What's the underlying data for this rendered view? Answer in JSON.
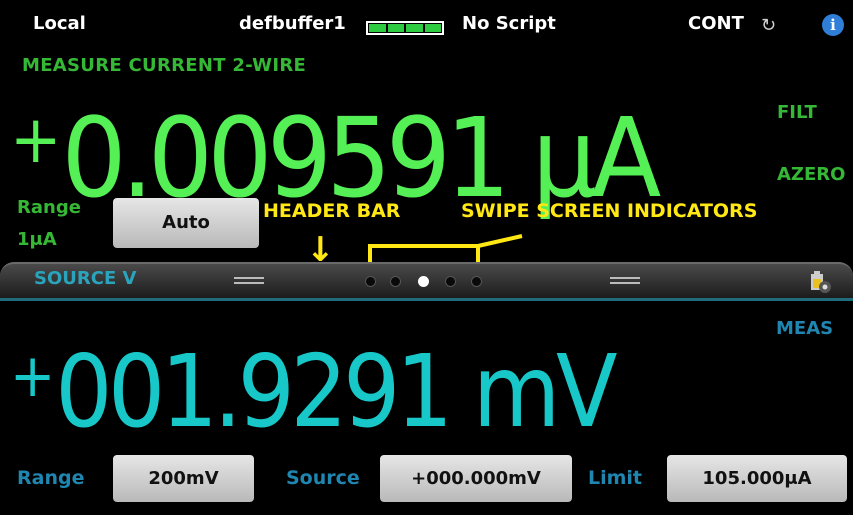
{
  "status_bar": {
    "mode": "Local",
    "buffer": "defbuffer1",
    "script": "No Script",
    "trigger": "CONT",
    "sync_icon": "sync-icon",
    "info_icon": "info-icon",
    "info_glyph": "i",
    "battery_fill": 1.0
  },
  "measure": {
    "function_label": "MEASURE CURRENT 2-WIRE",
    "value_sign": "+",
    "value": "0.009591 μA",
    "filter_indicator": "FILT",
    "azero_indicator": "AZERO",
    "range_label": "Range",
    "range_value": "1μA",
    "range_button": "Auto"
  },
  "annotations": {
    "header_bar": "HEADER BAR",
    "swipe_indicators": "SWIPE SCREEN INDICATORS",
    "arrow_glyph": "↓",
    "color": "#ffe814"
  },
  "swipe": {
    "title": "SOURCE V",
    "active_dot": 2,
    "dots": 5,
    "corner_icon": "battery-settings-icon"
  },
  "source": {
    "value_sign": "+",
    "value": "001.9291 mV",
    "meas_indicator": "MEAS",
    "range_label": "Range",
    "range_button": "200mV",
    "source_label": "Source",
    "source_button": "+000.000mV",
    "limit_label": "Limit",
    "limit_button": "105.000μA"
  }
}
